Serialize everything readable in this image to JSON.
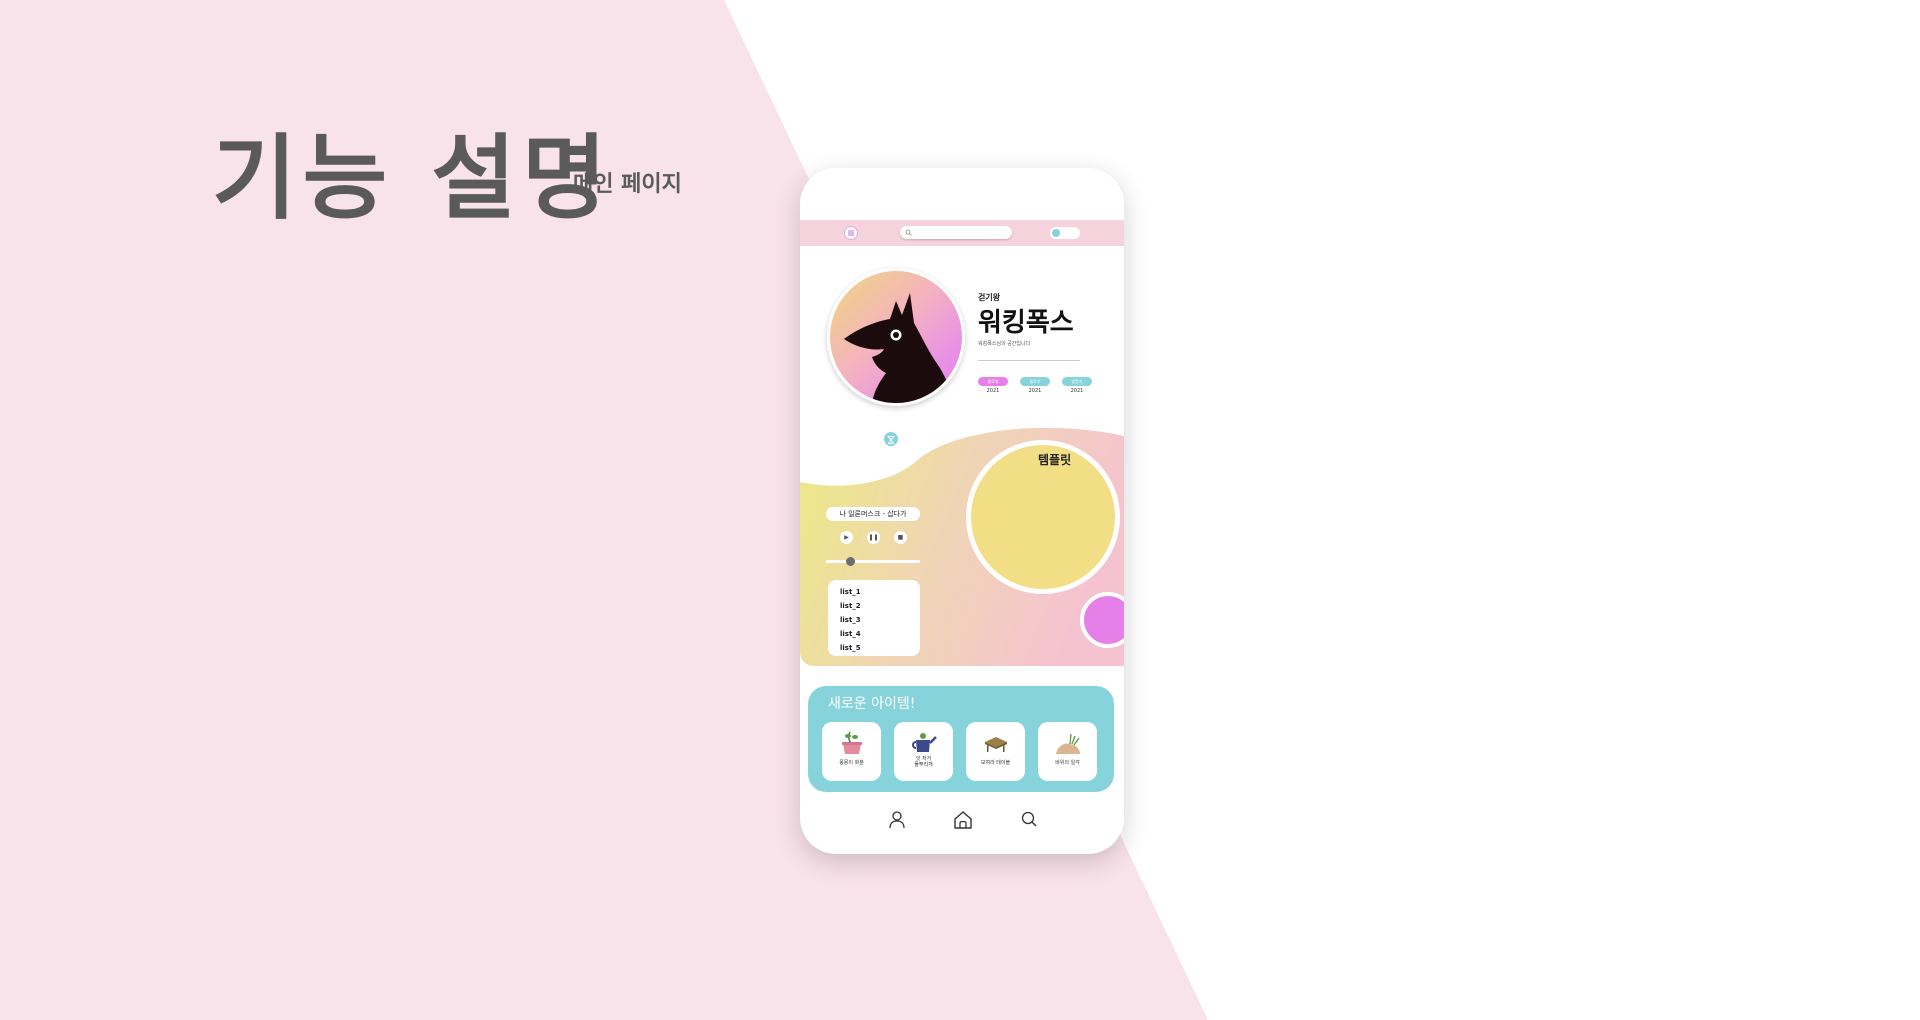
{
  "colors": {
    "background_pink": "#f9e3ea",
    "text_gray": "#5a5a5a",
    "topbar_pink": "#f5d3dd",
    "accent_teal": "#86d3dc",
    "accent_purple": "#e77fe8",
    "accent_yellow": "#f2df85"
  },
  "header": {
    "title": "기능 설명",
    "subtitle": "메인 페이지"
  },
  "phone": {
    "topbar": {
      "menu_icon": "menu-icon",
      "search_placeholder": "",
      "toggle_state": "on"
    },
    "profile": {
      "subname": "걷기왕",
      "name": "워킹폭스",
      "bio": "워킹폭스님의 공간입니다",
      "stats": [
        {
          "label": "팔로워",
          "year": "2021",
          "color": "#e77fe8"
        },
        {
          "label": "팔로우",
          "year": "2021",
          "color": "#86d3dc"
        },
        {
          "label": "방문자",
          "year": "2021",
          "color": "#86d3dc"
        }
      ]
    },
    "player": {
      "song": "나 일론머스크 - 삽다가",
      "controls": [
        "play-icon",
        "pause-icon",
        "stop-icon"
      ],
      "progress": 0.25,
      "playlist": [
        "list_1",
        "list_2",
        "list_3",
        "list_4",
        "list_5"
      ]
    },
    "template": {
      "label": "템플릿"
    },
    "shop": {
      "title": "새로운 아이템!",
      "items": [
        {
          "label": "몽몽이 화분",
          "icon": "flowerpot-icon"
        },
        {
          "label": "잇 저거 물뿌리개",
          "line1": "잇 저거",
          "line2": "물뿌리개",
          "icon": "watering-can-icon"
        },
        {
          "label": "모여라 테이블",
          "icon": "table-icon"
        },
        {
          "label": "바위의 일각",
          "icon": "rock-icon"
        }
      ]
    },
    "bottom_nav": [
      "profile-icon",
      "home-icon",
      "search-icon"
    ]
  }
}
